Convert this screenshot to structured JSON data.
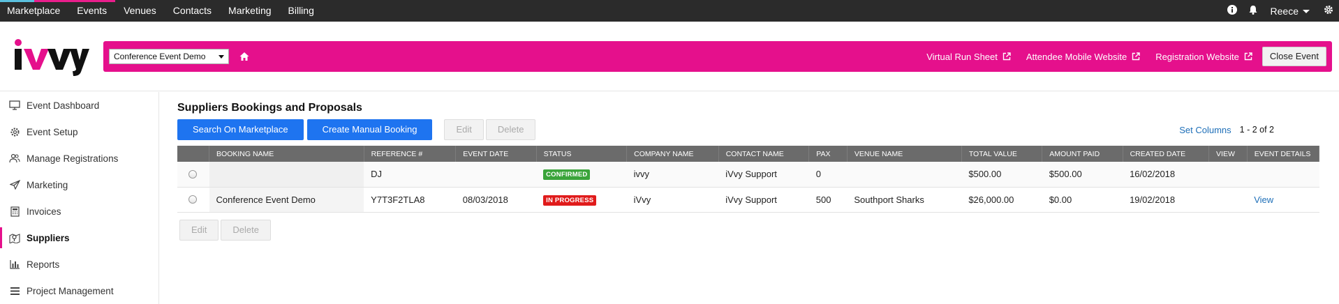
{
  "topnav": {
    "items": [
      "Marketplace",
      "Events",
      "Venues",
      "Contacts",
      "Marketing",
      "Billing"
    ],
    "user": "Reece"
  },
  "header": {
    "logo_text": "iVvy",
    "event_select": "Conference Event Demo",
    "links": [
      "Virtual Run Sheet",
      "Attendee Mobile Website",
      "Registration Website"
    ],
    "close_label": "Close Event",
    "accent": "#e5108c"
  },
  "sidebar": {
    "items": [
      {
        "label": "Event Dashboard",
        "icon": "monitor-icon"
      },
      {
        "label": "Event Setup",
        "icon": "gear-icon"
      },
      {
        "label": "Manage Registrations",
        "icon": "users-icon"
      },
      {
        "label": "Marketing",
        "icon": "paper-plane-icon"
      },
      {
        "label": "Invoices",
        "icon": "calculator-icon"
      },
      {
        "label": "Suppliers",
        "icon": "map-pin-icon"
      },
      {
        "label": "Reports",
        "icon": "bar-chart-icon"
      },
      {
        "label": "Project Management",
        "icon": "list-icon"
      }
    ],
    "active": "Suppliers"
  },
  "main": {
    "title": "Suppliers Bookings and Proposals",
    "buttons": {
      "search_marketplace": "Search On Marketplace",
      "create_manual": "Create Manual Booking",
      "edit": "Edit",
      "delete": "Delete"
    },
    "set_columns": "Set Columns",
    "pager": "1 - 2 of 2",
    "columns": [
      "",
      "BOOKING NAME",
      "REFERENCE #",
      "EVENT DATE",
      "STATUS",
      "COMPANY NAME",
      "CONTACT NAME",
      "PAX",
      "VENUE NAME",
      "TOTAL VALUE",
      "AMOUNT PAID",
      "CREATED DATE",
      "VIEW",
      "EVENT DETAILS"
    ],
    "rows": [
      {
        "booking_name": "",
        "reference": "DJ",
        "event_date": "",
        "status": "CONFIRMED",
        "status_color": "#3aa43a",
        "company": "ivvy",
        "contact": "iVvy Support",
        "pax": "0",
        "venue": "",
        "total": "$500.00",
        "paid": "$500.00",
        "created": "16/02/2018",
        "view": "",
        "event_details": ""
      },
      {
        "booking_name": "Conference Event Demo",
        "reference": "Y7T3F2TLA8",
        "event_date": "08/03/2018",
        "status": "IN PROGRESS",
        "status_color": "#e01b1b",
        "company": "iVvy",
        "contact": "iVvy Support",
        "pax": "500",
        "venue": "Southport Sharks",
        "total": "$26,000.00",
        "paid": "$0.00",
        "created": "19/02/2018",
        "view": "",
        "event_details": "View"
      }
    ]
  }
}
